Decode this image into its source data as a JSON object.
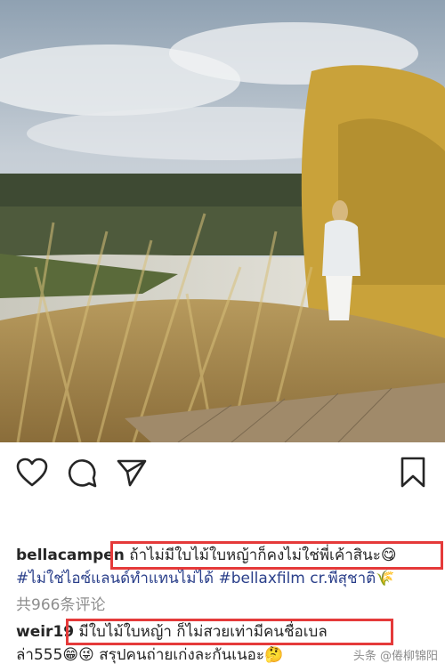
{
  "post": {
    "actions": {
      "like": "heart-icon",
      "comment": "comment-icon",
      "share": "share-icon",
      "save": "bookmark-icon"
    },
    "caption": {
      "username": "bellacampen",
      "text": "ถ้าไม่มีใบไม้ใบหญ้าก็คงไม่ใช่พี่เค้าสินะ😋",
      "hashtags": "#ไม่ใช่ไอซ์แลนด์ทำแทนไม่ได้ #bellaxfilm cr.พี่สุชาติ🌾"
    },
    "comment_count": "共966条评论",
    "comment": {
      "username": "weir19",
      "text": "มีใบไม้ใบหญ้า ก็ไม่สวยเท่ามีคนชื่อเบล",
      "text2": "ล่า555😁😜 สรุปคนถ่ายเก่งละกันเนอะ🤔"
    },
    "watermark": "头条 @倦柳锦阳"
  },
  "colors": {
    "highlight_box": "#e53a3a",
    "hashtag": "#2a3f8a",
    "muted": "#8e8e8e"
  }
}
